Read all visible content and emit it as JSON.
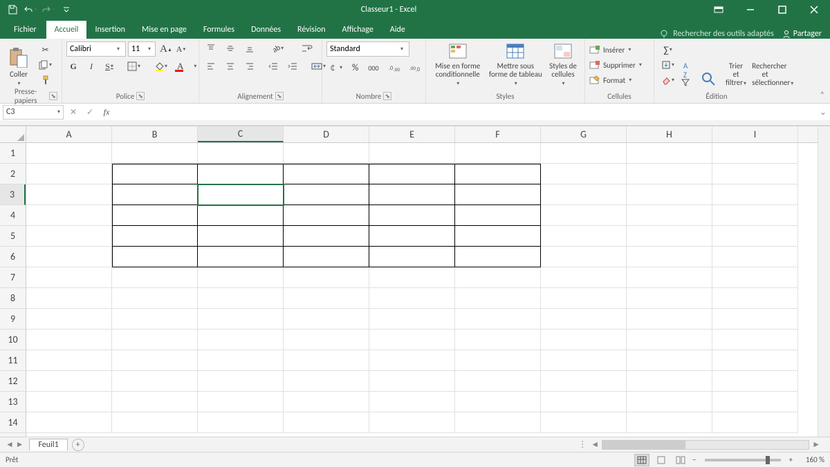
{
  "title": "Classeur1  -  Excel",
  "qat": {
    "save": "save-icon",
    "undo": "undo-icon",
    "redo": "redo-icon"
  },
  "tabs": {
    "file": "Fichier",
    "items": [
      "Accueil",
      "Insertion",
      "Mise en page",
      "Formules",
      "Données",
      "Révision",
      "Affichage",
      "Aide"
    ],
    "active": 0,
    "tellme": "Rechercher des outils adaptés",
    "share": "Partager"
  },
  "ribbon": {
    "clipboard": {
      "paste": "Coller",
      "label": "Presse-papiers"
    },
    "font": {
      "name": "Calibri",
      "size": "11",
      "label": "Police"
    },
    "alignment": {
      "label": "Alignement"
    },
    "number": {
      "format": "Standard",
      "label": "Nombre"
    },
    "styles": {
      "cond": "Mise en forme conditionnelle",
      "table": "Mettre sous forme de tableau",
      "cell": "Styles de cellules",
      "label": "Styles"
    },
    "cells": {
      "insert": "Insérer",
      "delete": "Supprimer",
      "format": "Format",
      "label": "Cellules"
    },
    "editing": {
      "sort": "Trier et filtrer",
      "find": "Rechercher et sélectionner",
      "label": "Édition"
    }
  },
  "formula_bar": {
    "name_box": "C3",
    "formula": ""
  },
  "grid": {
    "columns": [
      "A",
      "B",
      "C",
      "D",
      "E",
      "F",
      "G",
      "H",
      "I"
    ],
    "rows": [
      "1",
      "2",
      "3",
      "4",
      "5",
      "6",
      "7",
      "8",
      "9",
      "10",
      "11",
      "12",
      "13",
      "14"
    ],
    "selected": {
      "col": 2,
      "row": 2
    },
    "border_region": {
      "r1": 1,
      "r2": 5,
      "c1": 1,
      "c2": 5
    }
  },
  "sheets": {
    "active": "Feuil1"
  },
  "status": {
    "ready": "Prêt",
    "zoom": "160 %"
  }
}
